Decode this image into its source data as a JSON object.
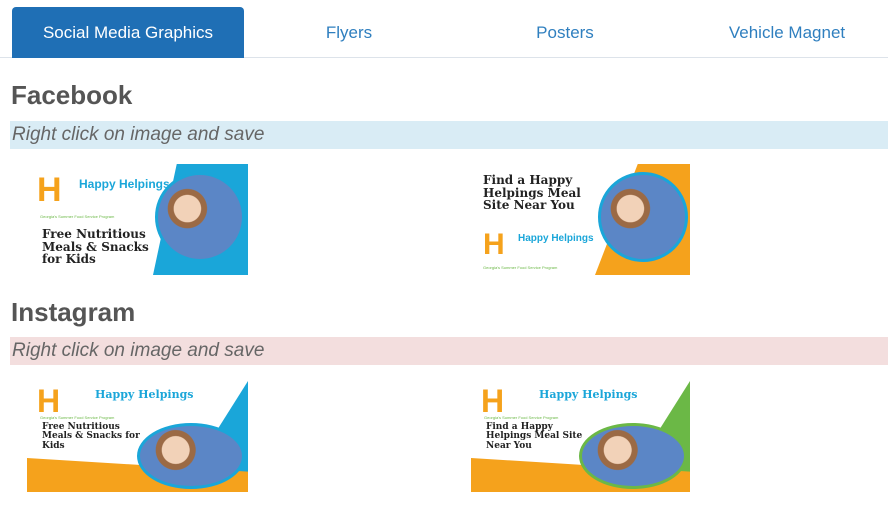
{
  "tabs": [
    {
      "label": "Social Media Graphics",
      "active": true
    },
    {
      "label": "Flyers",
      "active": false
    },
    {
      "label": "Posters",
      "active": false
    },
    {
      "label": "Vehicle Magnet",
      "active": false
    }
  ],
  "facebook": {
    "title": "Facebook",
    "instruction": "Right click on image and save",
    "graphics": [
      {
        "brand": "Happy Helpings",
        "tagline": "Georgia's Summer Food Service Program",
        "headline": "Free Nutritious Meals & Snacks for Kids"
      },
      {
        "brand": "Happy Helpings",
        "tagline": "Georgia's Summer Food Service Program",
        "headline": "Find a Happy Helpings Meal Site Near You"
      }
    ]
  },
  "instagram": {
    "title": "Instagram",
    "instruction": "Right click on image and save",
    "graphics": [
      {
        "brand": "Happy Helpings",
        "tagline": "Georgia's Summer Food Service Program",
        "headline": "Free Nutritious Meals & Snacks for Kids"
      },
      {
        "brand": "Happy Helpings",
        "tagline": "Georgia's Summer Food Service Program",
        "headline": "Find a Happy Helpings Meal Site Near You"
      }
    ]
  },
  "colors": {
    "tab_active_bg": "#1f6fb5",
    "tab_link": "#2f7fbf",
    "brand_blue": "#1aa6d9",
    "brand_green": "#6bb846",
    "brand_orange": "#f5a21c",
    "facebook_band": "#d9ecf5",
    "instagram_band": "#f3dede"
  }
}
